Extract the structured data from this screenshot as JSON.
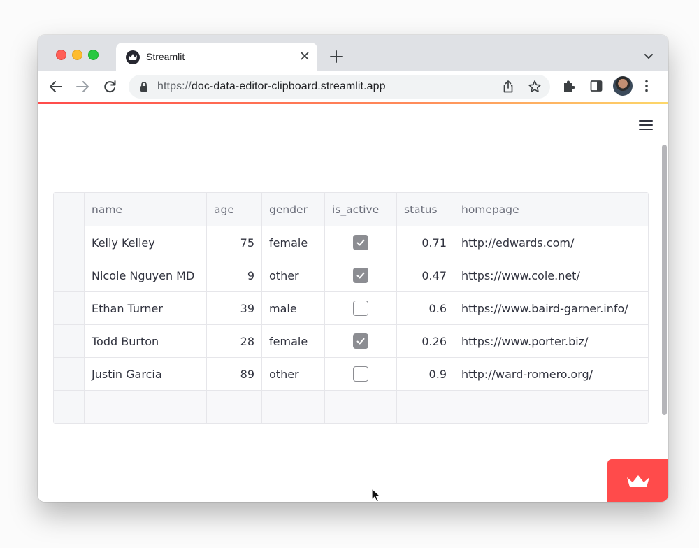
{
  "browser": {
    "tab_title": "Streamlit",
    "url": "https://doc-data-editor-clipboard.streamlit.app",
    "url_scheme": "https://",
    "url_host": "doc-data-editor-clipboard.streamlit.app"
  },
  "icons": {
    "favicon": "streamlit-crown-icon",
    "close": "close-icon",
    "new_tab": "plus-icon",
    "tab_list": "chevron-down-icon",
    "back": "arrow-left-icon",
    "forward": "arrow-right-icon",
    "reload": "reload-icon",
    "lock": "lock-icon",
    "share": "share-icon",
    "bookmark": "star-icon",
    "extensions": "puzzle-icon",
    "side_panel": "side-panel-icon",
    "menu": "kebab-icon",
    "app_menu": "hamburger-icon",
    "badge": "streamlit-crown-icon"
  },
  "colors": {
    "accent": "#ff4b4b",
    "header_bg": "#f6f7f9",
    "checkbox_checked": "#8c8d92"
  },
  "table": {
    "columns": [
      "name",
      "age",
      "gender",
      "is_active",
      "status",
      "homepage"
    ],
    "rows": [
      {
        "name": "Kelly Kelley",
        "age": "75",
        "gender": "female",
        "is_active": true,
        "status": "0.71",
        "homepage": "http://edwards.com/"
      },
      {
        "name": "Nicole Nguyen MD",
        "age": "9",
        "gender": "other",
        "is_active": true,
        "status": "0.47",
        "homepage": "https://www.cole.net/"
      },
      {
        "name": "Ethan Turner",
        "age": "39",
        "gender": "male",
        "is_active": false,
        "status": "0.6",
        "homepage": "https://www.baird-garner.info/"
      },
      {
        "name": "Todd Burton",
        "age": "28",
        "gender": "female",
        "is_active": true,
        "status": "0.26",
        "homepage": "https://www.porter.biz/"
      },
      {
        "name": "Justin Garcia",
        "age": "89",
        "gender": "other",
        "is_active": false,
        "status": "0.9",
        "homepage": "http://ward-romero.org/"
      }
    ]
  }
}
